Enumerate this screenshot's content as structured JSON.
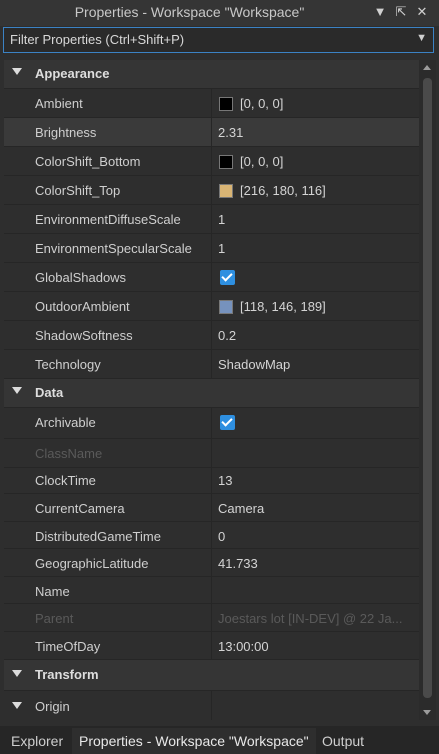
{
  "window": {
    "title": "Properties - Workspace \"Workspace\""
  },
  "filter": {
    "placeholder": "Filter Properties (Ctrl+Shift+P)"
  },
  "sections": [
    {
      "title": "Appearance",
      "properties": [
        {
          "name": "Ambient",
          "value": "[0, 0, 0]",
          "swatch": "#000000"
        },
        {
          "name": "Brightness",
          "value": "2.31"
        },
        {
          "name": "ColorShift_Bottom",
          "value": "[0, 0, 0]",
          "swatch": "#000000"
        },
        {
          "name": "ColorShift_Top",
          "value": "[216, 180, 116]",
          "swatch": "#d8b474"
        },
        {
          "name": "EnvironmentDiffuseScale",
          "value": "1"
        },
        {
          "name": "EnvironmentSpecularScale",
          "value": "1"
        },
        {
          "name": "GlobalShadows",
          "checked": true
        },
        {
          "name": "OutdoorAmbient",
          "value": "[118, 146, 189]",
          "swatch": "#7692bd"
        },
        {
          "name": "ShadowSoftness",
          "value": "0.2"
        },
        {
          "name": "Technology",
          "value": "ShadowMap"
        }
      ]
    },
    {
      "title": "Data",
      "properties": [
        {
          "name": "Archivable",
          "checked": true
        },
        {
          "name": "ClassName",
          "value": ""
        },
        {
          "name": "ClockTime",
          "value": "13"
        },
        {
          "name": "CurrentCamera",
          "value": "Camera"
        },
        {
          "name": "DistributedGameTime",
          "value": "0"
        },
        {
          "name": "GeographicLatitude",
          "value": "41.733"
        },
        {
          "name": "Name",
          "value": ""
        },
        {
          "name": "Parent",
          "value": "Joestars lot [IN-DEV] @ 22 Ja..."
        },
        {
          "name": "TimeOfDay",
          "value": "13:00:00"
        }
      ]
    },
    {
      "title": "Transform",
      "properties": [
        {
          "name": "Origin",
          "value": ""
        }
      ]
    }
  ],
  "tabs": [
    {
      "label": "Explorer"
    },
    {
      "label": "Properties - Workspace \"Workspace\""
    },
    {
      "label": "Output"
    }
  ]
}
